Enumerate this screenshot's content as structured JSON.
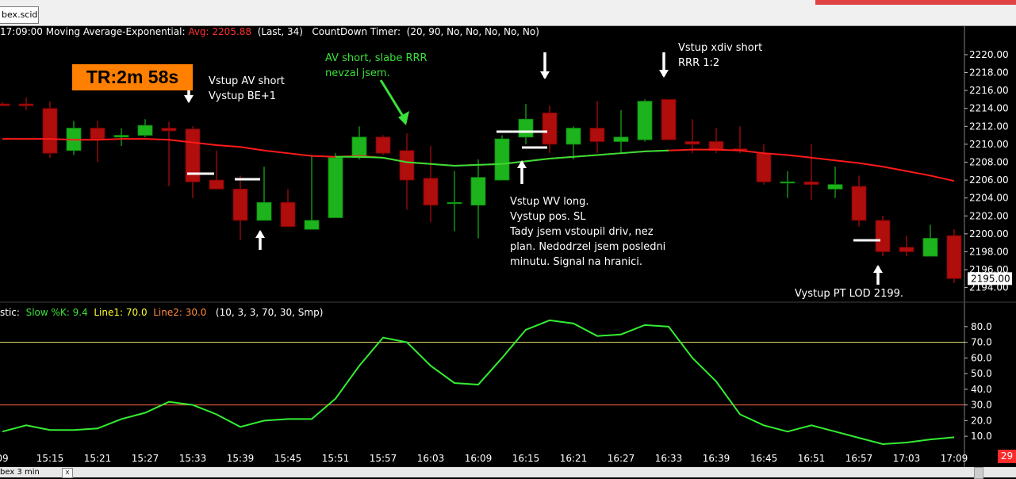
{
  "window": {
    "tab_label": "bex.scid",
    "bottom_tab_label": "bex 3 min",
    "bottom_tab_close": "x",
    "badge": "29"
  },
  "header": {
    "prefix": "17:09:00 Moving Average-Exponential:",
    "avg_label": "Avg: 2205.88",
    "avg_params": "(Last, 34)",
    "countdown_label": "CountDown Timer:",
    "countdown_params": "(20, 90, No, No, No, No, No)"
  },
  "timer_badge": "TR:2m 58s",
  "stoch_header": {
    "prefix": "stic:",
    "slowk": "Slow %K: 9.4",
    "line1": "Line1: 70.0",
    "line2": "Line2: 30.0",
    "params": "(10, 3, 3, 70, 30, Smp)"
  },
  "annotations": {
    "av_short": "Vstup AV short\nVystup BE+1",
    "av_short_green": "AV short, slabe RRR\nnevzal jsem.",
    "xdiv": "Vstup xdiv short\nRRR 1:2",
    "wv_long": "Vstup WV long.\nVystup pos. SL\nTady jsem vstoupil driv, nez\nplan. Nedodrzel jsem posledni\nminutu. Signal na hranici.",
    "pt_lod": "Vystup PT LOD 2199."
  },
  "colors": {
    "bull": "#1db31d",
    "bear": "#b00d0d",
    "ema": "#ff1a1a",
    "stoch": "#33ee33",
    "line70": "#e8e870",
    "line30": "#ff6a4a",
    "price_tag": "#ffffff"
  },
  "chart_data": [
    {
      "type": "candlestick",
      "y_ticks": [
        "2220.00",
        "2218.00",
        "2216.00",
        "2214.00",
        "2212.00",
        "2210.00",
        "2208.00",
        "2206.00",
        "2204.00",
        "2202.00",
        "2200.00",
        "2198.00",
        "2196.00",
        "2194.00"
      ],
      "ylim": [
        2193.7,
        2221.5
      ],
      "current_price_label": "2195.00",
      "x_ticks": [
        "09",
        "15:15",
        "15:21",
        "15:27",
        "15:33",
        "15:39",
        "15:45",
        "15:51",
        "15:57",
        "16:03",
        "16:09",
        "16:15",
        "16:21",
        "16:27",
        "16:33",
        "16:39",
        "16:45",
        "16:51",
        "16:57",
        "17:03",
        "17:09"
      ],
      "candles": [
        {
          "t": "15:09",
          "o": 2214.5,
          "h": 2214.7,
          "l": 2214.3,
          "c": 2214.3
        },
        {
          "t": "15:12",
          "o": 2214.5,
          "h": 2215.2,
          "l": 2213.8,
          "c": 2214.3
        },
        {
          "t": "15:15",
          "o": 2214.0,
          "h": 2214.8,
          "l": 2208.5,
          "c": 2209.0
        },
        {
          "t": "15:18",
          "o": 2209.3,
          "h": 2212.6,
          "l": 2208.8,
          "c": 2211.8
        },
        {
          "t": "15:21",
          "o": 2211.8,
          "h": 2212.6,
          "l": 2208.0,
          "c": 2210.6
        },
        {
          "t": "15:24",
          "o": 2210.8,
          "h": 2211.8,
          "l": 2209.8,
          "c": 2211.0
        },
        {
          "t": "15:27",
          "o": 2211.0,
          "h": 2212.8,
          "l": 2210.8,
          "c": 2212.1
        },
        {
          "t": "15:30",
          "o": 2211.8,
          "h": 2212.5,
          "l": 2205.3,
          "c": 2211.5
        },
        {
          "t": "15:33",
          "o": 2211.7,
          "h": 2212.0,
          "l": 2204.0,
          "c": 2205.8
        },
        {
          "t": "15:36",
          "o": 2206.0,
          "h": 2209.3,
          "l": 2205.0,
          "c": 2205.0
        },
        {
          "t": "15:39",
          "o": 2205.0,
          "h": 2206.5,
          "l": 2199.3,
          "c": 2201.5
        },
        {
          "t": "15:42",
          "o": 2201.5,
          "h": 2207.5,
          "l": 2201.5,
          "c": 2203.5
        },
        {
          "t": "15:45",
          "o": 2203.5,
          "h": 2205.0,
          "l": 2200.8,
          "c": 2200.8
        },
        {
          "t": "15:48",
          "o": 2200.5,
          "h": 2208.8,
          "l": 2200.5,
          "c": 2201.5
        },
        {
          "t": "15:51",
          "o": 2201.8,
          "h": 2209.0,
          "l": 2201.8,
          "c": 2208.5
        },
        {
          "t": "15:54",
          "o": 2208.5,
          "h": 2212.0,
          "l": 2208.3,
          "c": 2210.8
        },
        {
          "t": "15:57",
          "o": 2210.8,
          "h": 2211.0,
          "l": 2208.8,
          "c": 2209.0
        },
        {
          "t": "16:00",
          "o": 2209.3,
          "h": 2211.2,
          "l": 2202.7,
          "c": 2206.0
        },
        {
          "t": "16:03",
          "o": 2206.2,
          "h": 2209.8,
          "l": 2201.3,
          "c": 2203.2
        },
        {
          "t": "16:06",
          "o": 2203.5,
          "h": 2207.0,
          "l": 2200.3,
          "c": 2203.5
        },
        {
          "t": "16:09",
          "o": 2203.2,
          "h": 2208.3,
          "l": 2199.5,
          "c": 2206.3
        },
        {
          "t": "16:12",
          "o": 2206.0,
          "h": 2211.0,
          "l": 2206.0,
          "c": 2210.6
        },
        {
          "t": "16:15",
          "o": 2210.8,
          "h": 2214.5,
          "l": 2210.0,
          "c": 2212.8
        },
        {
          "t": "16:18",
          "o": 2213.5,
          "h": 2214.3,
          "l": 2209.0,
          "c": 2210.0
        },
        {
          "t": "16:21",
          "o": 2210.0,
          "h": 2212.0,
          "l": 2208.3,
          "c": 2211.8
        },
        {
          "t": "16:24",
          "o": 2211.8,
          "h": 2214.8,
          "l": 2209.0,
          "c": 2210.3
        },
        {
          "t": "16:27",
          "o": 2210.3,
          "h": 2213.8,
          "l": 2209.0,
          "c": 2210.8
        },
        {
          "t": "16:30",
          "o": 2210.5,
          "h": 2215.0,
          "l": 2210.3,
          "c": 2214.8
        },
        {
          "t": "16:33",
          "o": 2215.0,
          "h": 2215.0,
          "l": 2210.5,
          "c": 2210.5
        },
        {
          "t": "16:36",
          "o": 2210.3,
          "h": 2212.8,
          "l": 2209.0,
          "c": 2210.0
        },
        {
          "t": "16:39",
          "o": 2210.3,
          "h": 2211.8,
          "l": 2209.0,
          "c": 2209.3
        },
        {
          "t": "16:42",
          "o": 2209.5,
          "h": 2212.0,
          "l": 2209.0,
          "c": 2209.3
        },
        {
          "t": "16:45",
          "o": 2209.0,
          "h": 2210.0,
          "l": 2205.5,
          "c": 2205.8
        },
        {
          "t": "16:48",
          "o": 2205.8,
          "h": 2207.0,
          "l": 2204.0,
          "c": 2205.8
        },
        {
          "t": "16:51",
          "o": 2205.8,
          "h": 2210.0,
          "l": 2203.8,
          "c": 2205.5
        },
        {
          "t": "16:54",
          "o": 2205.0,
          "h": 2207.5,
          "l": 2204.0,
          "c": 2205.5
        },
        {
          "t": "16:57",
          "o": 2205.3,
          "h": 2206.5,
          "l": 2200.8,
          "c": 2201.5
        },
        {
          "t": "17:00",
          "o": 2201.5,
          "h": 2202.0,
          "l": 2197.5,
          "c": 2198.0
        },
        {
          "t": "17:03",
          "o": 2198.5,
          "h": 2199.8,
          "l": 2197.5,
          "c": 2198.0
        },
        {
          "t": "17:06",
          "o": 2197.5,
          "h": 2201.0,
          "l": 2197.5,
          "c": 2199.5
        },
        {
          "t": "17:09",
          "o": 2199.8,
          "h": 2200.5,
          "l": 2194.5,
          "c": 2195.0
        }
      ],
      "series": [
        {
          "name": "Avg",
          "values": [
            2210.6,
            2210.6,
            2210.6,
            2210.5,
            2210.5,
            2210.6,
            2210.6,
            2210.5,
            2210.2,
            2209.9,
            2209.7,
            2209.3,
            2209.0,
            2208.7,
            2208.6,
            2208.7,
            2208.5,
            2208.0,
            2207.8,
            2207.6,
            2207.7,
            2207.8,
            2208.1,
            2208.4,
            2208.6,
            2208.8,
            2209.0,
            2209.2,
            2209.3,
            2209.4,
            2209.4,
            2209.3,
            2209.0,
            2208.8,
            2208.5,
            2208.2,
            2207.9,
            2207.5,
            2207.0,
            2206.5,
            2205.9
          ]
        },
        {
          "name": "Avg",
          "values": [
            null,
            null,
            null,
            null,
            null,
            null,
            null,
            null,
            null,
            null,
            null,
            null,
            null,
            null,
            2208.6,
            2208.6,
            2208.5,
            2208.0,
            2207.8,
            2207.6,
            2207.7,
            2207.8,
            2208.1,
            2208.4,
            2208.6,
            2208.8,
            2209.0,
            2209.2,
            2209.3,
            null,
            null,
            null,
            null,
            null,
            null,
            null,
            null,
            null,
            null,
            null,
            null
          ]
        }
      ]
    },
    {
      "type": "line",
      "y_ticks": [
        "80.0",
        "70.0",
        "60.0",
        "50.0",
        "40.0",
        "30.0",
        "20.0",
        "10.0"
      ],
      "ylim": [
        4,
        87
      ],
      "series": [
        {
          "name": "Slow %K",
          "values": [
            13,
            17,
            14,
            14,
            15,
            21,
            25,
            32,
            30,
            24,
            16,
            20,
            21,
            21,
            34,
            55,
            73,
            70,
            55,
            44,
            43,
            60,
            78,
            84,
            82,
            74,
            75,
            81,
            80,
            60,
            45,
            24,
            17,
            13,
            17,
            13,
            9,
            5,
            6,
            8,
            9.4
          ]
        }
      ],
      "hlines": [
        70.0,
        30.0
      ]
    }
  ]
}
